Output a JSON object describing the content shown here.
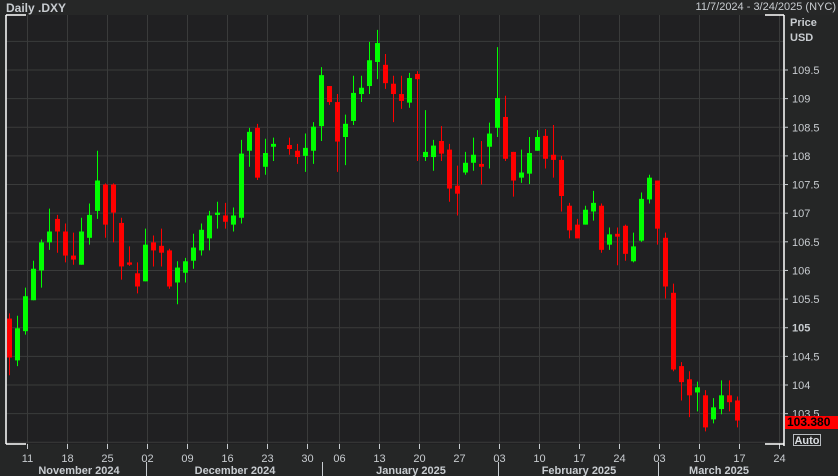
{
  "header": {
    "title": "Daily .DXY",
    "range": "11/7/2024 - 3/24/2025 (NYC)"
  },
  "y_axis": {
    "title1": "Price",
    "title2": "USD",
    "auto_label": "Auto"
  },
  "last_price": "103.380",
  "colors": {
    "up": "#00ff00",
    "down": "#ff0000",
    "background": "#202022",
    "grid": "#3a3b3b"
  },
  "chart_data": {
    "type": "candlestick",
    "title": "Daily .DXY",
    "ylabel": "Price USD",
    "ylim": [
      102.97,
      110.46
    ],
    "grid": true,
    "yticks": [
      {
        "v": 103.5,
        "label": "103.5"
      },
      {
        "v": 104,
        "label": "104"
      },
      {
        "v": 104.5,
        "label": "104.5"
      },
      {
        "v": 105,
        "label": "105",
        "bold": true
      },
      {
        "v": 105.5,
        "label": "105.5"
      },
      {
        "v": 106,
        "label": "106"
      },
      {
        "v": 106.5,
        "label": "106.5"
      },
      {
        "v": 107,
        "label": "107"
      },
      {
        "v": 107.5,
        "label": "107.5"
      },
      {
        "v": 108,
        "label": "108"
      },
      {
        "v": 108.5,
        "label": "108.5"
      },
      {
        "v": 109,
        "label": "109"
      },
      {
        "v": 109.5,
        "label": "109.5"
      }
    ],
    "grid_levels": [
      103,
      103.5,
      104,
      104.5,
      105,
      105.5,
      106,
      106.5,
      107,
      107.5,
      108,
      108.5,
      109,
      109.5,
      110
    ],
    "xticks": [
      {
        "d": "2024-11-11",
        "label": "11"
      },
      {
        "d": "2024-11-18",
        "label": "18"
      },
      {
        "d": "2024-11-25",
        "label": "25"
      },
      {
        "d": "2024-12-02",
        "label": "02"
      },
      {
        "d": "2024-12-09",
        "label": "09"
      },
      {
        "d": "2024-12-16",
        "label": "16"
      },
      {
        "d": "2024-12-23",
        "label": "23"
      },
      {
        "d": "2024-12-30",
        "label": "30"
      },
      {
        "d": "2025-01-06",
        "label": "06"
      },
      {
        "d": "2025-01-13",
        "label": "13"
      },
      {
        "d": "2025-01-20",
        "label": "20"
      },
      {
        "d": "2025-01-27",
        "label": "27"
      },
      {
        "d": "2025-02-03",
        "label": "03"
      },
      {
        "d": "2025-02-10",
        "label": "10"
      },
      {
        "d": "2025-02-17",
        "label": "17"
      },
      {
        "d": "2025-02-24",
        "label": "24"
      },
      {
        "d": "2025-03-03",
        "label": "03"
      },
      {
        "d": "2025-03-10",
        "label": "10"
      },
      {
        "d": "2025-03-17",
        "label": "17"
      },
      {
        "d": "2025-03-24",
        "label": "24"
      }
    ],
    "months": [
      {
        "label": "November 2024",
        "start": "2024-11-07"
      },
      {
        "label": "December 2024",
        "start": "2024-12-02"
      },
      {
        "label": "January 2025",
        "start": "2025-01-02"
      },
      {
        "label": "February 2025",
        "start": "2025-02-03"
      },
      {
        "label": "March 2025",
        "start": "2025-03-03"
      }
    ],
    "end_date": "2025-03-24",
    "candles": [
      [
        "2024-11-07",
        105.16,
        105.25,
        104.17,
        104.48
      ],
      [
        "2024-11-08",
        104.43,
        105.21,
        104.33,
        104.99
      ],
      [
        "2024-11-11",
        104.94,
        105.7,
        104.88,
        105.55
      ],
      [
        "2024-11-12",
        105.48,
        106.17,
        105.48,
        106.03
      ],
      [
        "2024-11-13",
        106.0,
        106.54,
        105.7,
        106.49
      ],
      [
        "2024-11-14",
        106.49,
        107.08,
        106.36,
        106.68
      ],
      [
        "2024-11-15",
        106.9,
        106.97,
        106.31,
        106.68
      ],
      [
        "2024-11-18",
        106.68,
        106.82,
        106.14,
        106.26
      ],
      [
        "2024-11-19",
        106.26,
        106.66,
        106.1,
        106.19
      ],
      [
        "2024-11-20",
        106.1,
        106.92,
        106.1,
        106.68
      ],
      [
        "2024-11-21",
        106.57,
        107.17,
        106.45,
        106.97
      ],
      [
        "2024-11-22",
        107.04,
        108.09,
        106.9,
        107.57
      ],
      [
        "2024-11-25",
        107.5,
        107.52,
        106.57,
        106.8
      ],
      [
        "2024-11-26",
        107.5,
        107.52,
        106.49,
        107.01
      ],
      [
        "2024-11-27",
        106.83,
        106.92,
        105.84,
        106.07
      ],
      [
        "2024-11-28",
        106.14,
        106.42,
        106.08,
        106.1
      ],
      [
        "2024-11-29",
        105.95,
        106.14,
        105.6,
        105.72
      ],
      [
        "2024-12-02",
        105.81,
        106.73,
        105.81,
        106.45
      ],
      [
        "2024-12-03",
        106.49,
        106.61,
        106.07,
        106.35
      ],
      [
        "2024-12-04",
        106.43,
        106.73,
        106.07,
        106.31
      ],
      [
        "2024-12-05",
        106.35,
        106.38,
        105.68,
        105.72
      ],
      [
        "2024-12-06",
        105.79,
        106.16,
        105.41,
        106.05
      ],
      [
        "2024-12-09",
        105.96,
        106.22,
        105.79,
        106.16
      ],
      [
        "2024-12-10",
        106.17,
        106.64,
        106.03,
        106.4
      ],
      [
        "2024-12-11",
        106.35,
        106.82,
        106.26,
        106.71
      ],
      [
        "2024-12-12",
        106.56,
        107.04,
        106.35,
        106.96
      ],
      [
        "2024-12-13",
        106.97,
        107.2,
        106.73,
        107.01
      ],
      [
        "2024-12-16",
        106.96,
        107.18,
        106.73,
        106.85
      ],
      [
        "2024-12-17",
        106.8,
        107.1,
        106.68,
        106.96
      ],
      [
        "2024-12-18",
        106.92,
        108.28,
        106.82,
        108.04
      ],
      [
        "2024-12-19",
        108.09,
        108.49,
        107.81,
        108.42
      ],
      [
        "2024-12-20",
        108.49,
        108.56,
        107.58,
        107.62
      ],
      [
        "2024-12-23",
        107.81,
        108.3,
        107.67,
        108.05
      ],
      [
        "2024-12-24",
        108.16,
        108.32,
        107.91,
        108.21
      ],
      [
        "2024-12-25",
        null,
        null,
        null,
        null
      ],
      [
        "2024-12-26",
        108.19,
        108.32,
        108.02,
        108.12
      ],
      [
        "2024-12-27",
        108.09,
        108.21,
        107.86,
        107.98
      ],
      [
        "2024-12-30",
        108.0,
        108.39,
        107.72,
        108.14
      ],
      [
        "2024-12-31",
        108.09,
        108.59,
        107.86,
        108.51
      ],
      [
        "2025-01-02",
        108.52,
        109.55,
        108.26,
        109.41
      ],
      [
        "2025-01-03",
        109.22,
        109.22,
        108.89,
        108.94
      ],
      [
        "2025-01-06",
        108.94,
        109.08,
        107.72,
        108.25
      ],
      [
        "2025-01-07",
        108.33,
        108.72,
        107.84,
        108.56
      ],
      [
        "2025-01-08",
        108.61,
        109.4,
        108.54,
        109.1
      ],
      [
        "2025-01-09",
        109.08,
        109.4,
        108.94,
        109.19
      ],
      [
        "2025-01-10",
        109.22,
        109.99,
        109.08,
        109.67
      ],
      [
        "2025-01-13",
        109.64,
        110.2,
        109.34,
        109.97
      ],
      [
        "2025-01-14",
        109.59,
        109.78,
        109.17,
        109.27
      ],
      [
        "2025-01-15",
        109.26,
        109.4,
        108.59,
        109.08
      ],
      [
        "2025-01-16",
        109.08,
        109.4,
        108.82,
        108.96
      ],
      [
        "2025-01-17",
        108.93,
        109.45,
        108.84,
        109.36
      ],
      [
        "2025-01-20",
        109.43,
        109.48,
        107.91,
        109.34
      ],
      [
        "2025-01-21",
        107.98,
        108.8,
        107.91,
        108.07
      ],
      [
        "2025-01-22",
        107.98,
        108.28,
        107.74,
        108.18
      ],
      [
        "2025-01-23",
        108.26,
        108.52,
        107.91,
        108.04
      ],
      [
        "2025-01-24",
        108.11,
        108.21,
        107.2,
        107.43
      ],
      [
        "2025-01-27",
        107.48,
        107.83,
        106.96,
        107.34
      ],
      [
        "2025-01-28",
        107.71,
        108.07,
        107.67,
        107.88
      ],
      [
        "2025-01-29",
        107.88,
        108.32,
        107.74,
        108.02
      ],
      [
        "2025-01-30",
        107.86,
        108.26,
        107.5,
        107.81
      ],
      [
        "2025-01-31",
        108.16,
        108.58,
        107.78,
        108.39
      ],
      [
        "2025-02-03",
        108.49,
        109.9,
        108.33,
        109.01
      ],
      [
        "2025-02-04",
        108.68,
        109.05,
        107.91,
        107.95
      ],
      [
        "2025-02-05",
        108.07,
        108.07,
        107.29,
        107.57
      ],
      [
        "2025-02-06",
        107.62,
        108.11,
        107.53,
        107.71
      ],
      [
        "2025-02-07",
        107.69,
        108.33,
        107.51,
        108.05
      ],
      [
        "2025-02-10",
        108.09,
        108.45,
        108.09,
        108.33
      ],
      [
        "2025-02-11",
        108.35,
        108.47,
        107.78,
        107.95
      ],
      [
        "2025-02-12",
        108.02,
        108.54,
        107.62,
        107.93
      ],
      [
        "2025-02-13",
        107.93,
        108.0,
        107.03,
        107.3
      ],
      [
        "2025-02-14",
        107.13,
        107.18,
        106.56,
        106.7
      ],
      [
        "2025-02-17",
        106.8,
        106.9,
        106.56,
        106.56
      ],
      [
        "2025-02-18",
        106.8,
        107.13,
        106.8,
        107.06
      ],
      [
        "2025-02-19",
        107.03,
        107.39,
        106.87,
        107.18
      ],
      [
        "2025-02-20",
        107.13,
        107.17,
        106.31,
        106.36
      ],
      [
        "2025-02-21",
        106.45,
        106.75,
        106.36,
        106.63
      ],
      [
        "2025-02-24",
        106.64,
        106.75,
        106.09,
        106.59
      ],
      [
        "2025-02-25",
        106.78,
        106.8,
        106.17,
        106.29
      ],
      [
        "2025-02-26",
        106.16,
        106.66,
        106.14,
        106.42
      ],
      [
        "2025-02-27",
        106.52,
        107.36,
        106.5,
        107.25
      ],
      [
        "2025-02-28",
        107.24,
        107.67,
        107.17,
        107.62
      ],
      [
        "2025-03-03",
        107.57,
        107.57,
        106.45,
        106.73
      ],
      [
        "2025-03-04",
        106.57,
        106.66,
        105.51,
        105.72
      ],
      [
        "2025-03-05",
        105.61,
        105.77,
        104.24,
        104.27
      ],
      [
        "2025-03-06",
        104.33,
        104.4,
        103.73,
        104.05
      ],
      [
        "2025-03-07",
        104.1,
        104.24,
        103.44,
        103.82
      ],
      [
        "2025-03-10",
        103.87,
        104.06,
        103.54,
        103.96
      ],
      [
        "2025-03-11",
        103.82,
        103.91,
        103.19,
        103.26
      ],
      [
        "2025-03-12",
        103.4,
        103.77,
        103.33,
        103.61
      ],
      [
        "2025-03-13",
        103.58,
        104.08,
        103.49,
        103.82
      ],
      [
        "2025-03-14",
        103.82,
        104.08,
        103.54,
        103.7
      ],
      [
        "2025-03-17",
        103.73,
        103.8,
        103.26,
        103.38
      ]
    ]
  }
}
